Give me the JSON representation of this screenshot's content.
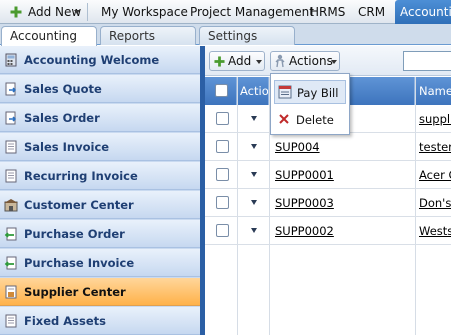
{
  "topbar": {
    "add_new": "Add New",
    "items": [
      "My Workspace",
      "Project Management",
      "HRMS",
      "CRM",
      "Accounting"
    ]
  },
  "tabs": [
    "Accounting",
    "Reports",
    "Settings"
  ],
  "sidebar": {
    "items": [
      {
        "label": "Accounting Welcome",
        "icon": "calculator-icon"
      },
      {
        "label": "Sales Quote",
        "icon": "document-arrow-icon"
      },
      {
        "label": "Sales Order",
        "icon": "document-arrow-icon"
      },
      {
        "label": "Sales Invoice",
        "icon": "document-icon"
      },
      {
        "label": "Recurring Invoice",
        "icon": "document-icon"
      },
      {
        "label": "Customer Center",
        "icon": "building-icon"
      },
      {
        "label": "Purchase Order",
        "icon": "document-green-arrow-icon"
      },
      {
        "label": "Purchase Invoice",
        "icon": "document-green-arrow-icon"
      },
      {
        "label": "Supplier Center",
        "icon": "supplier-icon"
      },
      {
        "label": "Fixed Assets",
        "icon": "document-icon"
      }
    ],
    "selected": "Supplier Center"
  },
  "toolbar": {
    "add_label": "Add",
    "actions_label": "Actions"
  },
  "grid": {
    "headers": {
      "action": "Action",
      "name": "Name"
    },
    "rows": [
      {
        "code": "",
        "name": "supplier"
      },
      {
        "code": "SUP004",
        "name": "tester"
      },
      {
        "code": "SUPP0001",
        "name": "Acer C"
      },
      {
        "code": "SUPP0003",
        "name": "Don's s"
      },
      {
        "code": "SUPP0002",
        "name": "Westsi"
      }
    ]
  },
  "actions_menu": {
    "items": [
      "Pay Bill",
      "Delete"
    ]
  },
  "colors": {
    "selected_nav": "#ffb24a",
    "header_blue": "#3d74bd",
    "active_tab": "#2f6fb8"
  }
}
